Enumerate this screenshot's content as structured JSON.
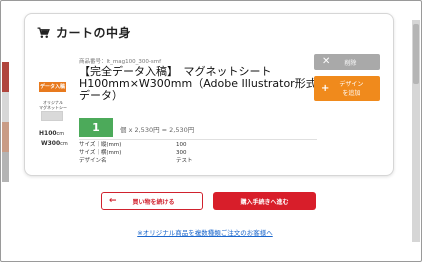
{
  "card": {
    "title": "カートの中身"
  },
  "product": {
    "image": {
      "tag": "データ入稿",
      "caption": "オリジナル\nマグネットシート",
      "dim1_value": "H100",
      "dim1_unit": "cm",
      "dim2_value": "W300",
      "dim2_unit": "cm"
    },
    "sku": "商品番号：lt_mag100_300-smf",
    "name": "【完全データ入稿】　マグネットシート H100mm×W300mm（Adobe Illustrator形式データ）",
    "quantity": "1",
    "price_text": "個 x 2,530円 = 2,530円",
    "specs": [
      {
        "key": "サイズ｜縦(mm)",
        "value": "100"
      },
      {
        "key": "サイズ｜横(mm)",
        "value": "300"
      },
      {
        "key": "デザイン名",
        "value": "テスト"
      }
    ]
  },
  "actions": {
    "delete_label": "削除",
    "add_design_label": "デザイン\nを追加",
    "continue_label": "買い物を続ける",
    "checkout_label": "購入手続きへ進む",
    "bulk_link": "※オリジナル商品を複数種類ご注文のお客様へ"
  },
  "colors": {
    "quantity_bg": "#4caa5a",
    "design_button": "#f08a1c",
    "checkout_button": "#d81e2a",
    "link": "#1a66cc"
  }
}
